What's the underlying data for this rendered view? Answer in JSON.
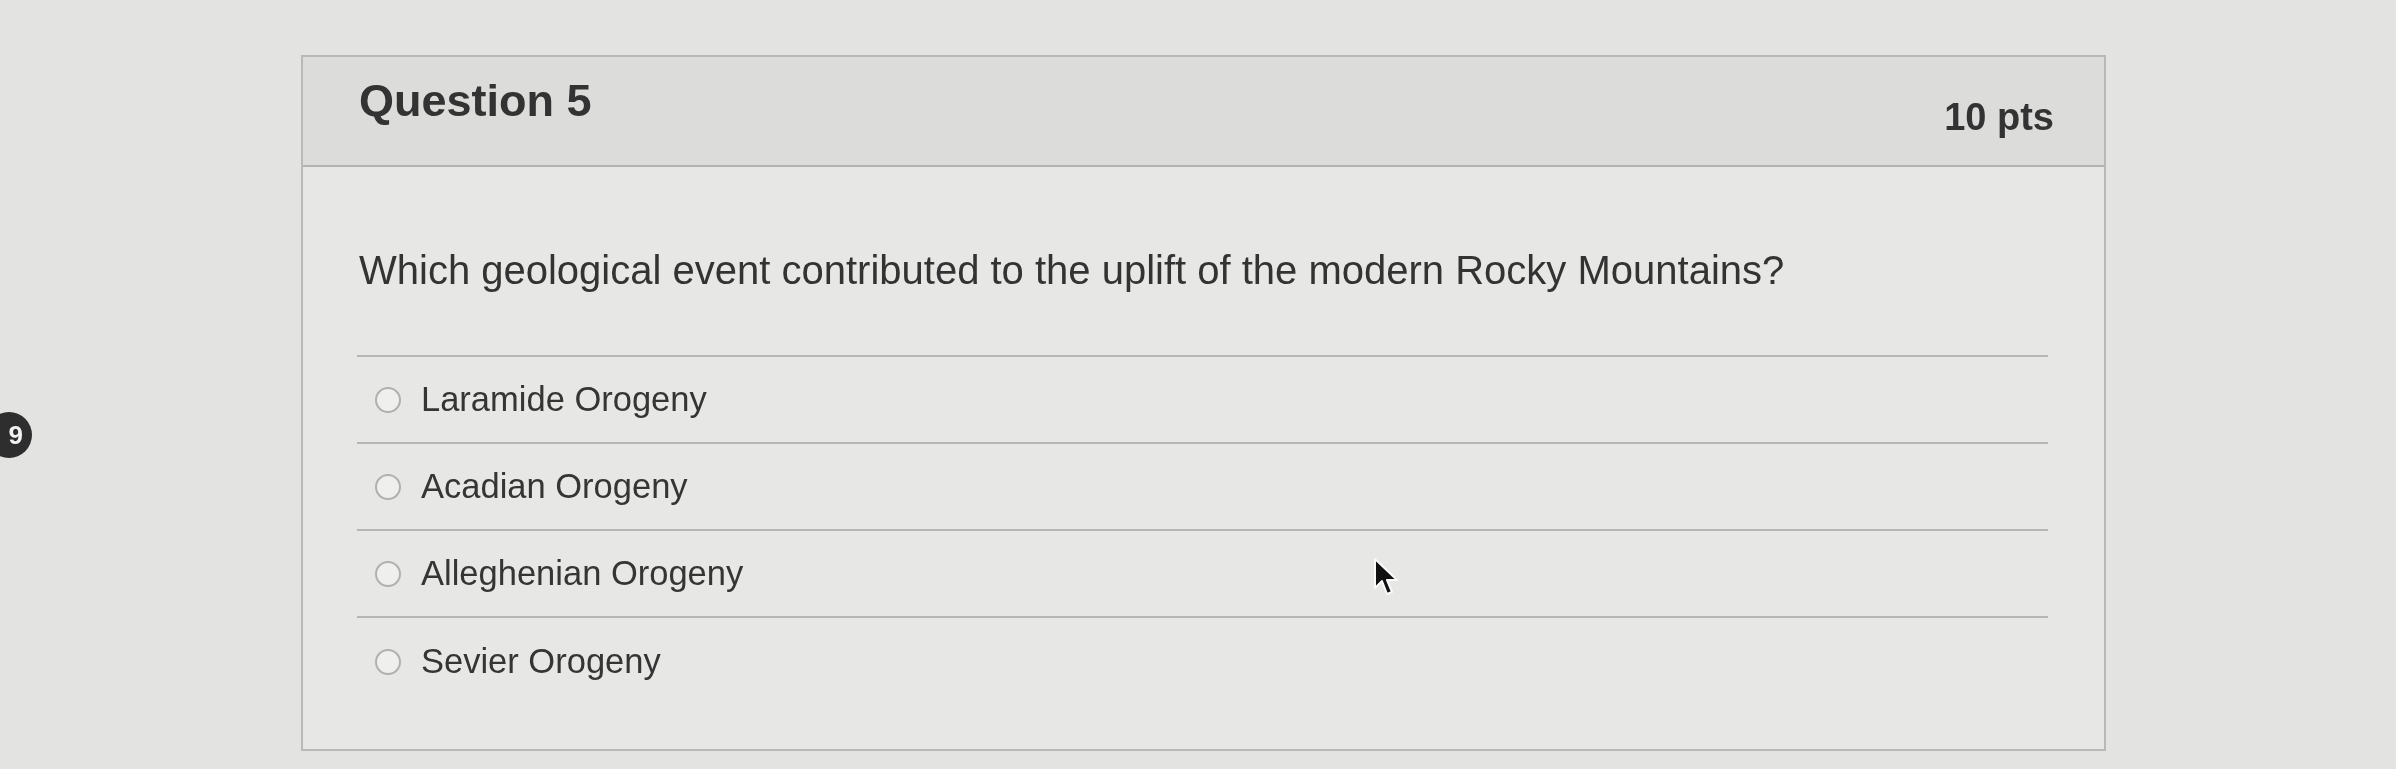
{
  "side_badge": {
    "label": "9"
  },
  "question": {
    "title": "Question 5",
    "points": "10 pts",
    "prompt": "Which geological event contributed to the uplift of the modern Rocky Mountains?",
    "options": [
      {
        "label": "Laramide Orogeny",
        "selected": false
      },
      {
        "label": "Acadian Orogeny",
        "selected": false
      },
      {
        "label": "Alleghenian Orogeny",
        "selected": false
      },
      {
        "label": "Sevier Orogeny",
        "selected": false
      }
    ]
  }
}
